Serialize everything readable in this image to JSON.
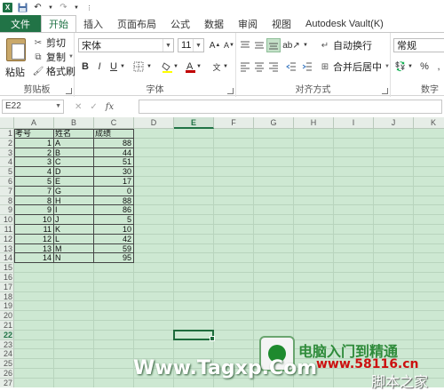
{
  "quick_access": {
    "app_icon": "excel-logo-icon",
    "icons": [
      "save-icon",
      "undo-icon",
      "redo-icon"
    ]
  },
  "tabs": [
    {
      "label": "文件",
      "kind": "file"
    },
    {
      "label": "开始",
      "kind": "active"
    },
    {
      "label": "插入",
      "kind": ""
    },
    {
      "label": "页面布局",
      "kind": ""
    },
    {
      "label": "公式",
      "kind": ""
    },
    {
      "label": "数据",
      "kind": ""
    },
    {
      "label": "审阅",
      "kind": ""
    },
    {
      "label": "视图",
      "kind": ""
    },
    {
      "label": "Autodesk Vault(K)",
      "kind": ""
    }
  ],
  "ribbon": {
    "clipboard": {
      "paste": "粘贴",
      "cut": "剪切",
      "copy": "复制",
      "format_painter": "格式刷",
      "label": "剪贴板"
    },
    "font": {
      "font_name": "宋体",
      "font_size": "11",
      "bold": "B",
      "italic": "I",
      "underline": "U",
      "font_color": "#c00000",
      "label": "字体"
    },
    "alignment": {
      "wrap_text": "自动换行",
      "merge_center": "合并后居中",
      "label": "对齐方式"
    },
    "number": {
      "format": "常规",
      "percent": "%",
      "label": "数字"
    }
  },
  "formula_bar": {
    "name_box": "E22",
    "fx": "fx",
    "formula": ""
  },
  "sheet": {
    "columns": [
      "A",
      "B",
      "C",
      "D",
      "E",
      "F",
      "G",
      "H",
      "I",
      "J",
      "K"
    ],
    "selected_column": "E",
    "row_numbers": [
      "1",
      "2",
      "3",
      "4",
      "5",
      "6",
      "7",
      "8",
      "9",
      "10",
      "11",
      "12",
      "13",
      "14",
      "15",
      "16",
      "17",
      "18",
      "19",
      "20",
      "21",
      "22",
      "23",
      "24",
      "25",
      "26",
      "27"
    ],
    "selected_row": "22",
    "headers": {
      "a": "考号",
      "b": "姓名",
      "c": "成绩"
    },
    "rows": [
      {
        "a": "1",
        "b": "A",
        "c": "88"
      },
      {
        "a": "2",
        "b": "B",
        "c": "44"
      },
      {
        "a": "3",
        "b": "C",
        "c": "51"
      },
      {
        "a": "4",
        "b": "D",
        "c": "30"
      },
      {
        "a": "5",
        "b": "E",
        "c": "17"
      },
      {
        "a": "7",
        "b": "G",
        "c": "0"
      },
      {
        "a": "8",
        "b": "H",
        "c": "88"
      },
      {
        "a": "9",
        "b": "I",
        "c": "86"
      },
      {
        "a": "10",
        "b": "J",
        "c": "5"
      },
      {
        "a": "11",
        "b": "K",
        "c": "10"
      },
      {
        "a": "12",
        "b": "L",
        "c": "42"
      },
      {
        "a": "13",
        "b": "M",
        "c": "59"
      },
      {
        "a": "14",
        "b": "N",
        "c": "95"
      }
    ]
  },
  "watermark": {
    "site_text": "Www.Tagxp.Com",
    "cn_title": "电脑入门到精通",
    "cn_url": "www.58116.cn",
    "cn_sub": "脚本之家",
    "logo_icon": "tagxp-logo-icon"
  }
}
